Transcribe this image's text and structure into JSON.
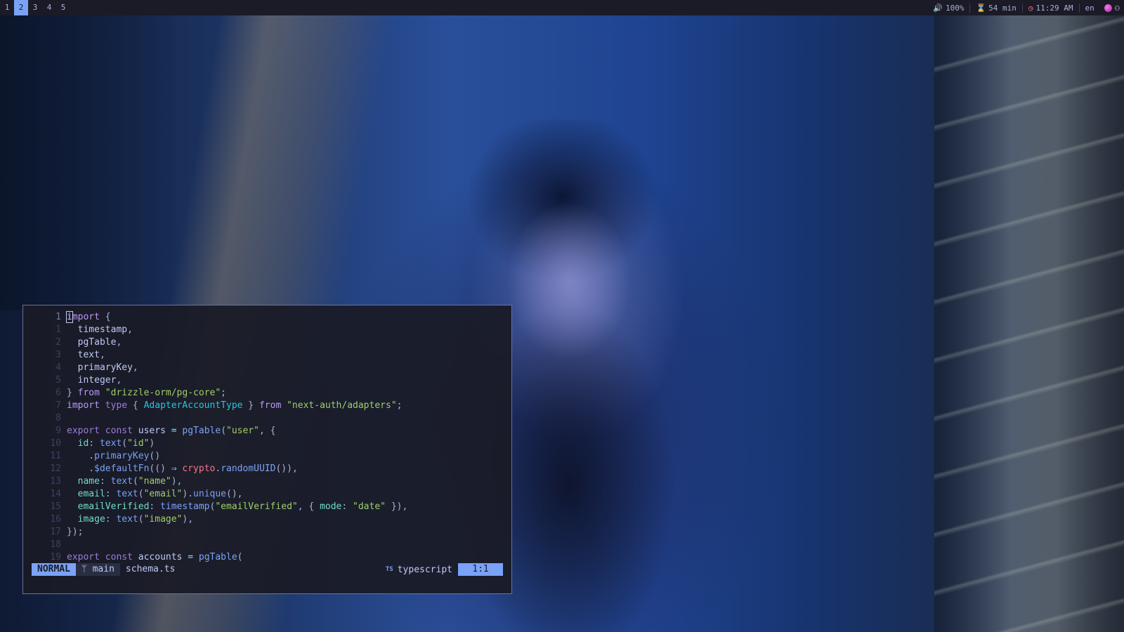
{
  "workspaces": [
    "1",
    "2",
    "3",
    "4",
    "5"
  ],
  "active_workspace": "2",
  "status": {
    "volume": "100%",
    "timer": "54 min",
    "clock": "11:29 AM",
    "lang": "en"
  },
  "editor": {
    "lines": [
      {
        "num": "1",
        "current": true
      },
      {
        "num": "1"
      },
      {
        "num": "2"
      },
      {
        "num": "3"
      },
      {
        "num": "4"
      },
      {
        "num": "5"
      },
      {
        "num": "6"
      },
      {
        "num": "7"
      },
      {
        "num": "8"
      },
      {
        "num": "9"
      },
      {
        "num": "10"
      },
      {
        "num": "11"
      },
      {
        "num": "12"
      },
      {
        "num": "13"
      },
      {
        "num": "14"
      },
      {
        "num": "15"
      },
      {
        "num": "16"
      },
      {
        "num": "17"
      },
      {
        "num": "18"
      },
      {
        "num": "19"
      }
    ],
    "tokens": [
      [
        [
          "cursor",
          "i"
        ],
        [
          "kw2",
          "mport"
        ],
        [
          "punc",
          " {"
        ]
      ],
      [
        [
          "txt",
          "  timestamp"
        ],
        [
          "punc",
          ","
        ]
      ],
      [
        [
          "txt",
          "  pgTable"
        ],
        [
          "punc",
          ","
        ]
      ],
      [
        [
          "txt",
          "  text"
        ],
        [
          "punc",
          ","
        ]
      ],
      [
        [
          "txt",
          "  primaryKey"
        ],
        [
          "punc",
          ","
        ]
      ],
      [
        [
          "txt",
          "  integer"
        ],
        [
          "punc",
          ","
        ]
      ],
      [
        [
          "punc",
          "} "
        ],
        [
          "kw2",
          "from"
        ],
        [
          "txt",
          " "
        ],
        [
          "str",
          "\"drizzle-orm/pg-core\""
        ],
        [
          "punc",
          ";"
        ]
      ],
      [
        [
          "kw2",
          "import"
        ],
        [
          "txt",
          " "
        ],
        [
          "kw",
          "type"
        ],
        [
          "punc",
          " { "
        ],
        [
          "type",
          "AdapterAccountType"
        ],
        [
          "punc",
          " } "
        ],
        [
          "kw2",
          "from"
        ],
        [
          "txt",
          " "
        ],
        [
          "str",
          "\"next-auth/adapters\""
        ],
        [
          "punc",
          ";"
        ]
      ],
      [],
      [
        [
          "kw",
          "export"
        ],
        [
          "txt",
          " "
        ],
        [
          "kw",
          "const"
        ],
        [
          "txt",
          " users "
        ],
        [
          "op",
          "="
        ],
        [
          "txt",
          " "
        ],
        [
          "fn",
          "pgTable"
        ],
        [
          "punc",
          "("
        ],
        [
          "str",
          "\"user\""
        ],
        [
          "punc",
          ", {"
        ]
      ],
      [
        [
          "prop",
          "  id"
        ],
        [
          "punc",
          ": "
        ],
        [
          "fn",
          "text"
        ],
        [
          "punc",
          "("
        ],
        [
          "str",
          "\"id\""
        ],
        [
          "punc",
          ")"
        ]
      ],
      [
        [
          "punc",
          "    ."
        ],
        [
          "fn",
          "primaryKey"
        ],
        [
          "punc",
          "()"
        ]
      ],
      [
        [
          "punc",
          "    ."
        ],
        [
          "fn",
          "$defaultFn"
        ],
        [
          "punc",
          "(() "
        ],
        [
          "op",
          "⇒"
        ],
        [
          "txt",
          " "
        ],
        [
          "obj",
          "crypto"
        ],
        [
          "punc",
          "."
        ],
        [
          "fn",
          "randomUUID"
        ],
        [
          "punc",
          "()),"
        ]
      ],
      [
        [
          "prop",
          "  name"
        ],
        [
          "punc",
          ": "
        ],
        [
          "fn",
          "text"
        ],
        [
          "punc",
          "("
        ],
        [
          "str",
          "\"name\""
        ],
        [
          "punc",
          "),"
        ]
      ],
      [
        [
          "prop",
          "  email"
        ],
        [
          "punc",
          ": "
        ],
        [
          "fn",
          "text"
        ],
        [
          "punc",
          "("
        ],
        [
          "str",
          "\"email\""
        ],
        [
          "punc",
          ")."
        ],
        [
          "fn",
          "unique"
        ],
        [
          "punc",
          "(),"
        ]
      ],
      [
        [
          "prop",
          "  emailVerified"
        ],
        [
          "punc",
          ": "
        ],
        [
          "fn",
          "timestamp"
        ],
        [
          "punc",
          "("
        ],
        [
          "str",
          "\"emailVerified\""
        ],
        [
          "punc",
          ", { "
        ],
        [
          "prop",
          "mode"
        ],
        [
          "punc",
          ": "
        ],
        [
          "str",
          "\"date\""
        ],
        [
          "punc",
          " }),"
        ]
      ],
      [
        [
          "prop",
          "  image"
        ],
        [
          "punc",
          ": "
        ],
        [
          "fn",
          "text"
        ],
        [
          "punc",
          "("
        ],
        [
          "str",
          "\"image\""
        ],
        [
          "punc",
          "),"
        ]
      ],
      [
        [
          "punc",
          "});"
        ]
      ],
      [],
      [
        [
          "kw",
          "export"
        ],
        [
          "txt",
          " "
        ],
        [
          "kw",
          "const"
        ],
        [
          "txt",
          " accounts "
        ],
        [
          "op",
          "="
        ],
        [
          "txt",
          " "
        ],
        [
          "fn",
          "pgTable"
        ],
        [
          "punc",
          "("
        ]
      ]
    ],
    "mode": "NORMAL",
    "branch_icon": "",
    "branch": "main",
    "filename": "schema.ts",
    "lang_badge": "TS",
    "language": "typescript",
    "position": "1:1"
  },
  "colors": {
    "accent": "#7aa2f7",
    "bar_bg": "#1a1b26"
  },
  "icons": {
    "volume": "volume-icon",
    "timer": "hourglass-icon",
    "clock": "clock-icon",
    "tray": "tray-icon"
  }
}
